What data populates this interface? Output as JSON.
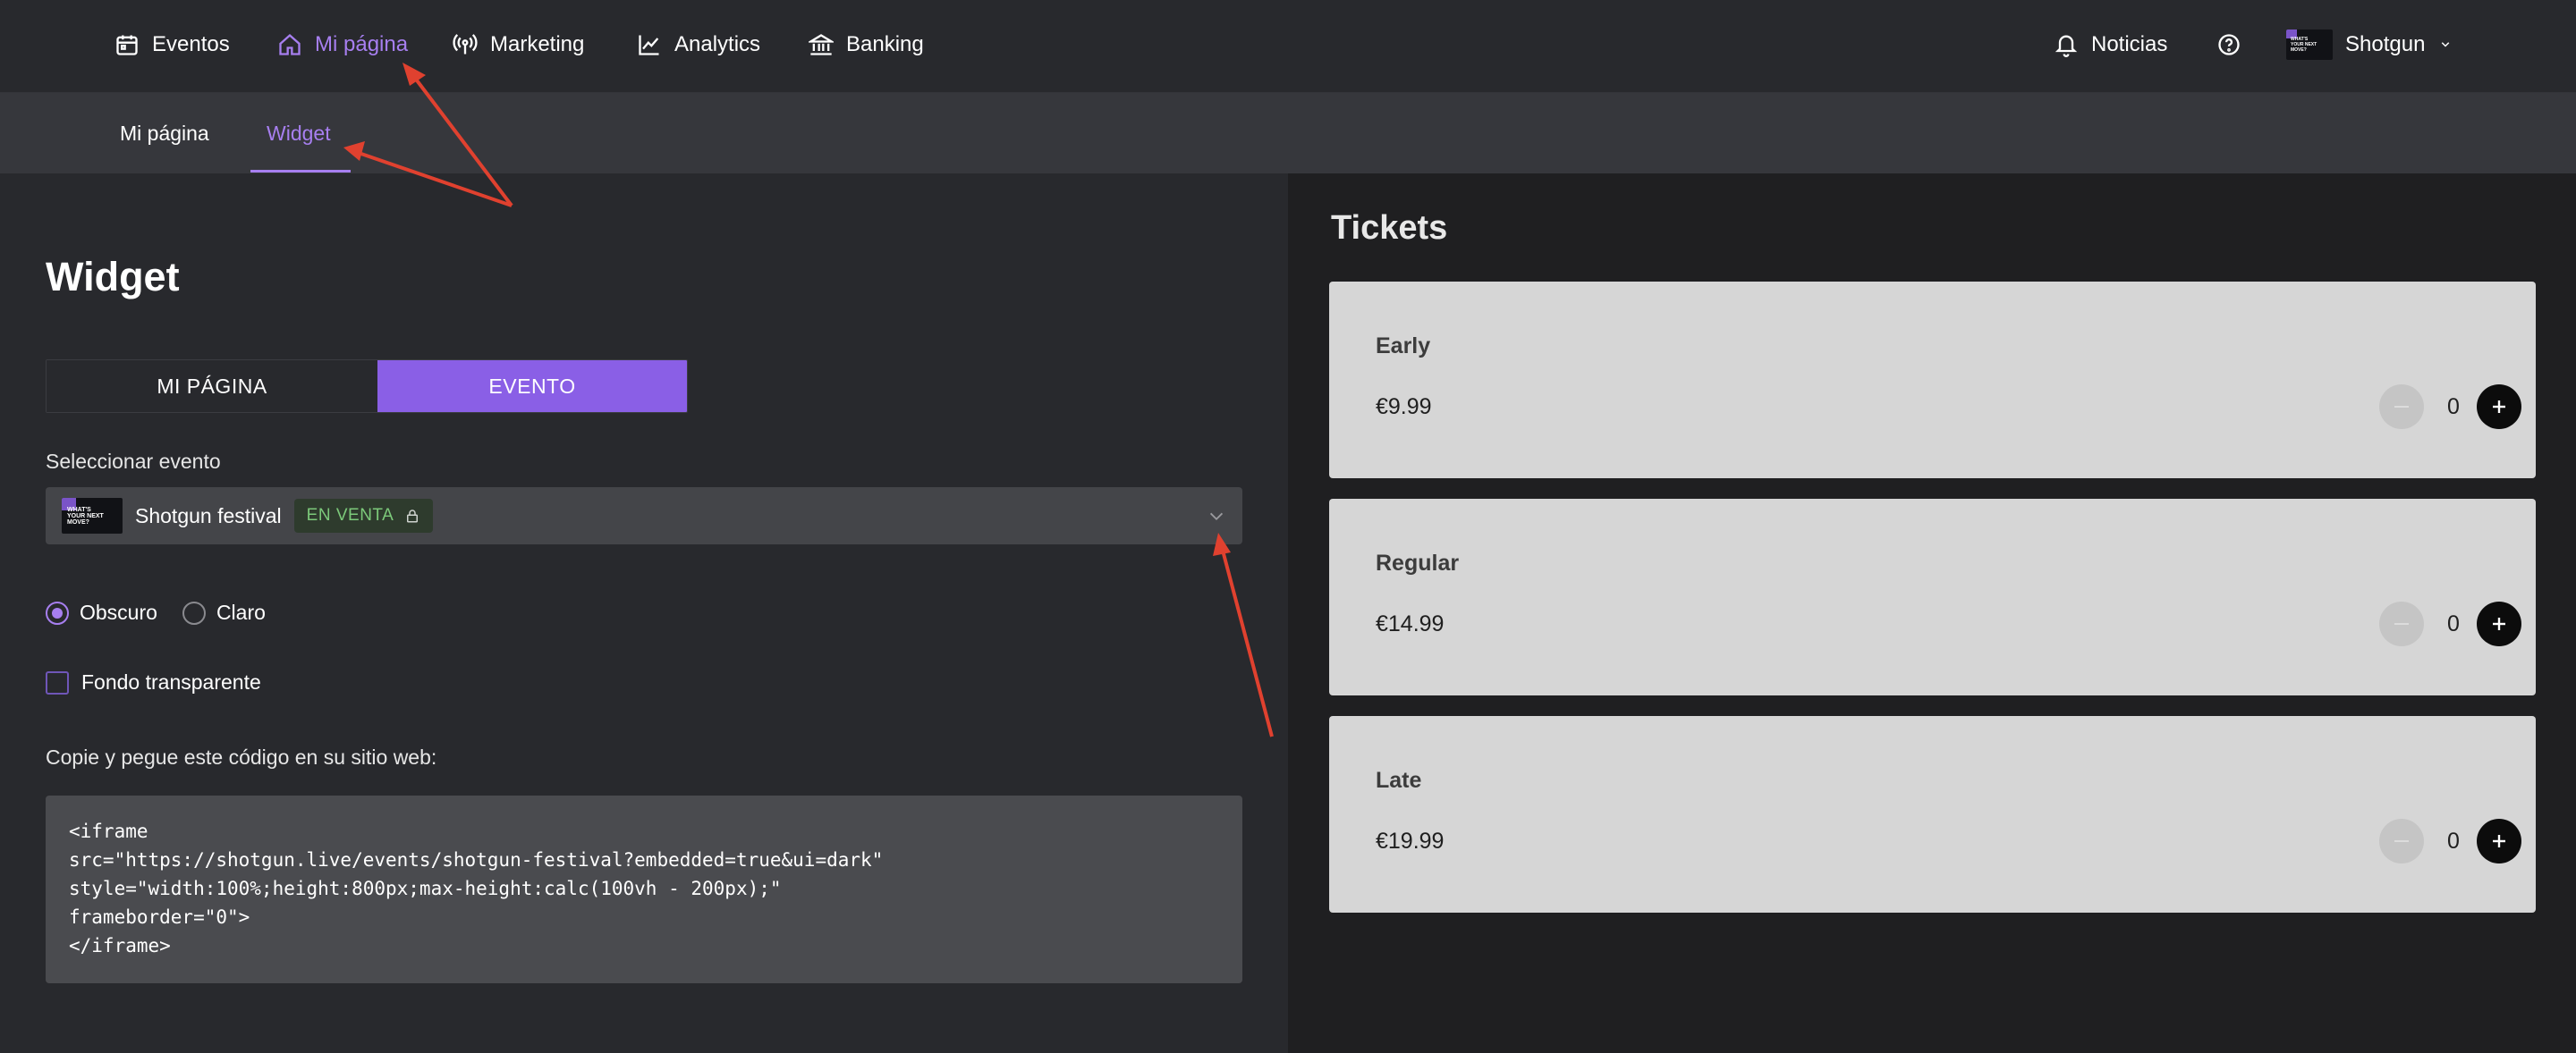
{
  "topnav": {
    "items": [
      {
        "label": "Eventos",
        "icon": "calendar-icon"
      },
      {
        "label": "Mi página",
        "icon": "home-icon",
        "active": true
      },
      {
        "label": "Marketing",
        "icon": "broadcast-icon"
      },
      {
        "label": "Analytics",
        "icon": "chart-line-icon"
      },
      {
        "label": "Banking",
        "icon": "bank-icon"
      }
    ],
    "notifications_label": "Noticias",
    "account_name": "Shotgun",
    "account_avatar_text": "WHAT'S YOUR NEXT MOVE?"
  },
  "subnav": {
    "items": [
      {
        "label": "Mi página"
      },
      {
        "label": "Widget",
        "active": true
      }
    ]
  },
  "left": {
    "title": "Widget",
    "segment": {
      "options": [
        "MI PÁGINA",
        "EVENTO"
      ],
      "selected": "EVENTO"
    },
    "select_label": "Seleccionar evento",
    "selected_event": {
      "name": "Shotgun festival",
      "status": "EN VENTA",
      "thumb_text": "WHAT'S YOUR NEXT MOVE?"
    },
    "theme": {
      "options": [
        "Obscuro",
        "Claro"
      ],
      "selected": "Obscuro"
    },
    "transparent_bg_label": "Fondo transparente",
    "transparent_bg_checked": false,
    "copy_label": "Copie y pegue este código en su sitio web:",
    "code_lines": [
      "<iframe",
      "src=\"https://shotgun.live/events/shotgun-festival?embedded=true&ui=dark\"",
      "style=\"width:100%;height:800px;max-height:calc(100vh - 200px);\"",
      "frameborder=\"0\">",
      "</iframe>"
    ]
  },
  "right": {
    "title": "Tickets",
    "tickets": [
      {
        "name": "Early",
        "price": "€9.99",
        "qty": "0"
      },
      {
        "name": "Regular",
        "price": "€14.99",
        "qty": "0"
      },
      {
        "name": "Late",
        "price": "€19.99",
        "qty": "0"
      }
    ]
  },
  "colors": {
    "accent": "#a77ff0",
    "segment_active": "#8a5fe6",
    "status_green": "#7cc97a",
    "annotation_arrow": "#e0412f"
  }
}
